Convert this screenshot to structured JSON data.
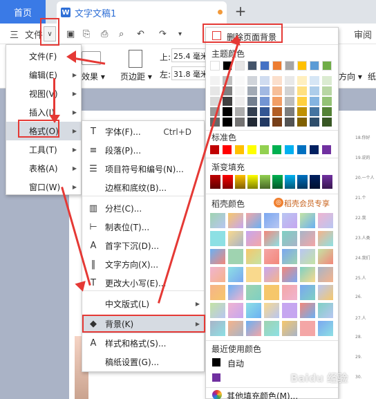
{
  "tabs": {
    "home": "首页",
    "doc": "文字文稿1",
    "new": "+"
  },
  "toolbar": {
    "menu": "三",
    "file": "文件"
  },
  "ribbon": {
    "effects": "效果",
    "margin": "页边距",
    "top_label": "上:",
    "top_value": "25.4 毫米",
    "left_label": "左:",
    "left_value": "31.8 毫米",
    "direction": "方向",
    "paper": "纸",
    "review": "审阅"
  },
  "menu_main": [
    {
      "label": "文件(F)",
      "arrow": ""
    },
    {
      "label": "编辑(E)",
      "arrow": "▶"
    },
    {
      "label": "视图(V)",
      "arrow": "▶"
    },
    {
      "label": "插入(I)",
      "arrow": "▶"
    },
    {
      "label": "格式(O)",
      "arrow": "▶"
    },
    {
      "label": "工具(T)",
      "arrow": "▶"
    },
    {
      "label": "表格(A)",
      "arrow": "▶"
    },
    {
      "label": "窗口(W)",
      "arrow": "▶"
    }
  ],
  "menu_format": [
    {
      "label": "字体(F)...",
      "shortcut": "Ctrl+D",
      "icon": "T"
    },
    {
      "label": "段落(P)...",
      "shortcut": "",
      "icon": "≡"
    },
    {
      "label": "项目符号和编号(N)...",
      "shortcut": "",
      "icon": "☰"
    },
    {
      "label": "边框和底纹(B)...",
      "shortcut": "",
      "icon": ""
    },
    {
      "label": "分栏(C)...",
      "shortcut": "",
      "icon": "▥"
    },
    {
      "label": "制表位(T)...",
      "shortcut": "",
      "icon": "⊢"
    },
    {
      "label": "首字下沉(D)...",
      "shortcut": "",
      "icon": "A"
    },
    {
      "label": "文字方向(X)...",
      "shortcut": "",
      "icon": "‖"
    },
    {
      "label": "更改大小写(E)...",
      "shortcut": "",
      "icon": "T"
    },
    {
      "label": "中文版式(L)",
      "shortcut": "",
      "icon": ""
    },
    {
      "label": "背景(K)",
      "shortcut": "",
      "icon": "◆"
    },
    {
      "label": "样式和格式(S)...",
      "shortcut": "",
      "icon": "A"
    },
    {
      "label": "稿纸设置(G)...",
      "shortcut": "",
      "icon": ""
    }
  ],
  "bg_panel": {
    "delete": "删除页面背景",
    "theme": "主题颜色",
    "standard": "标准色",
    "gradient": "渐变填充",
    "daoke": "稻壳颜色",
    "vip": "稻壳会员专享",
    "recent": "最近使用颜色",
    "auto": "自动",
    "more": "其他填充颜色(M)..."
  },
  "colors": {
    "theme_top": [
      "#ffffff",
      "#000000",
      "#e7e6e6",
      "#44546a",
      "#4472c4",
      "#ed7d31",
      "#a5a5a5",
      "#ffc000",
      "#5b9bd5",
      "#70ad47"
    ],
    "standard": [
      "#c00000",
      "#ff0000",
      "#ffc000",
      "#ffff00",
      "#92d050",
      "#00b050",
      "#00b0f0",
      "#0070c0",
      "#002060",
      "#7030a0"
    ],
    "recent": [
      "#7030a0"
    ]
  },
  "ruler": [
    "18.你好",
    "19.说的",
    "20.一个人",
    "21.个",
    "22.我",
    "23.人类",
    "24.我们",
    "25.人",
    "26.",
    "27.人",
    "28.",
    "29.",
    "30."
  ],
  "watermark": "Baidu 经验"
}
